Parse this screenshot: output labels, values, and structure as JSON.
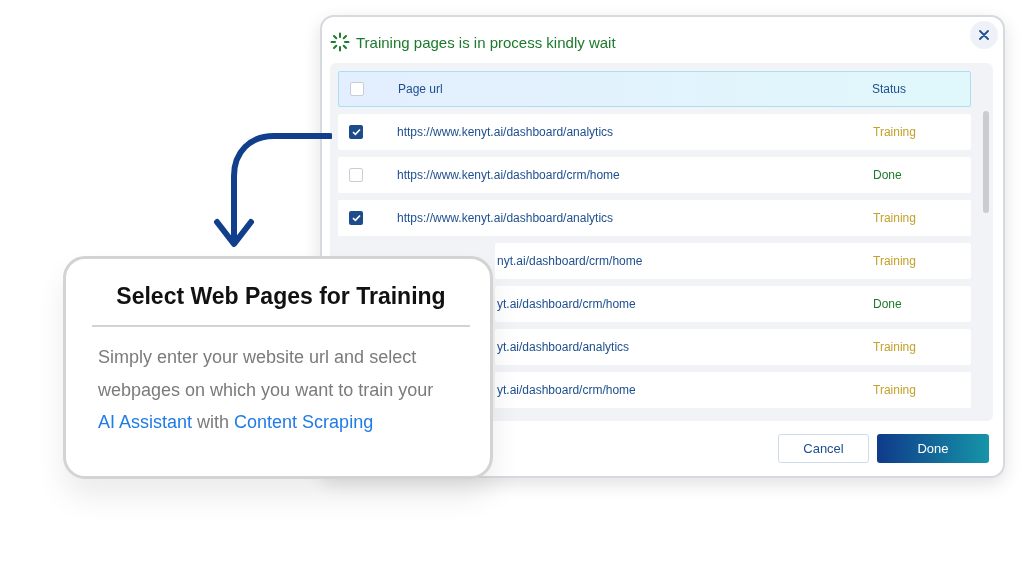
{
  "dialog": {
    "title": "Training pages is in process kindly wait",
    "table": {
      "columns": [
        "Page url",
        "Status"
      ],
      "select_all": {
        "checked": false
      },
      "rows": [
        {
          "checked": true,
          "url": "https://www.kenyt.ai/dashboard/analytics",
          "status": "Training",
          "kind": "training"
        },
        {
          "checked": false,
          "url": "https://www.kenyt.ai/dashboard/crm/home",
          "status": "Done",
          "kind": "done"
        },
        {
          "checked": true,
          "url": "https://www.kenyt.ai/dashboard/analytics",
          "status": "Training",
          "kind": "training"
        },
        {
          "url": "nyt.ai/dashboard/crm/home",
          "status": "Training",
          "kind": "training"
        },
        {
          "url": "yt.ai/dashboard/crm/home",
          "status": "Done",
          "kind": "done"
        },
        {
          "url": "yt.ai/dashboard/analytics",
          "status": "Training",
          "kind": "training"
        },
        {
          "url": "yt.ai/dashboard/crm/home",
          "status": "Training",
          "kind": "training"
        }
      ]
    },
    "buttons": [
      "Cancel",
      "Done"
    ]
  },
  "callout": {
    "title": "Select Web Pages for Training",
    "description": [
      {
        "kind": "text",
        "text": "Simply enter your website url and select webpages on which you want to train your "
      },
      {
        "kind": "link",
        "text": "AI Assistant"
      },
      {
        "kind": "text",
        "text": " with "
      },
      {
        "kind": "link",
        "text": "Content Scraping"
      }
    ]
  }
}
